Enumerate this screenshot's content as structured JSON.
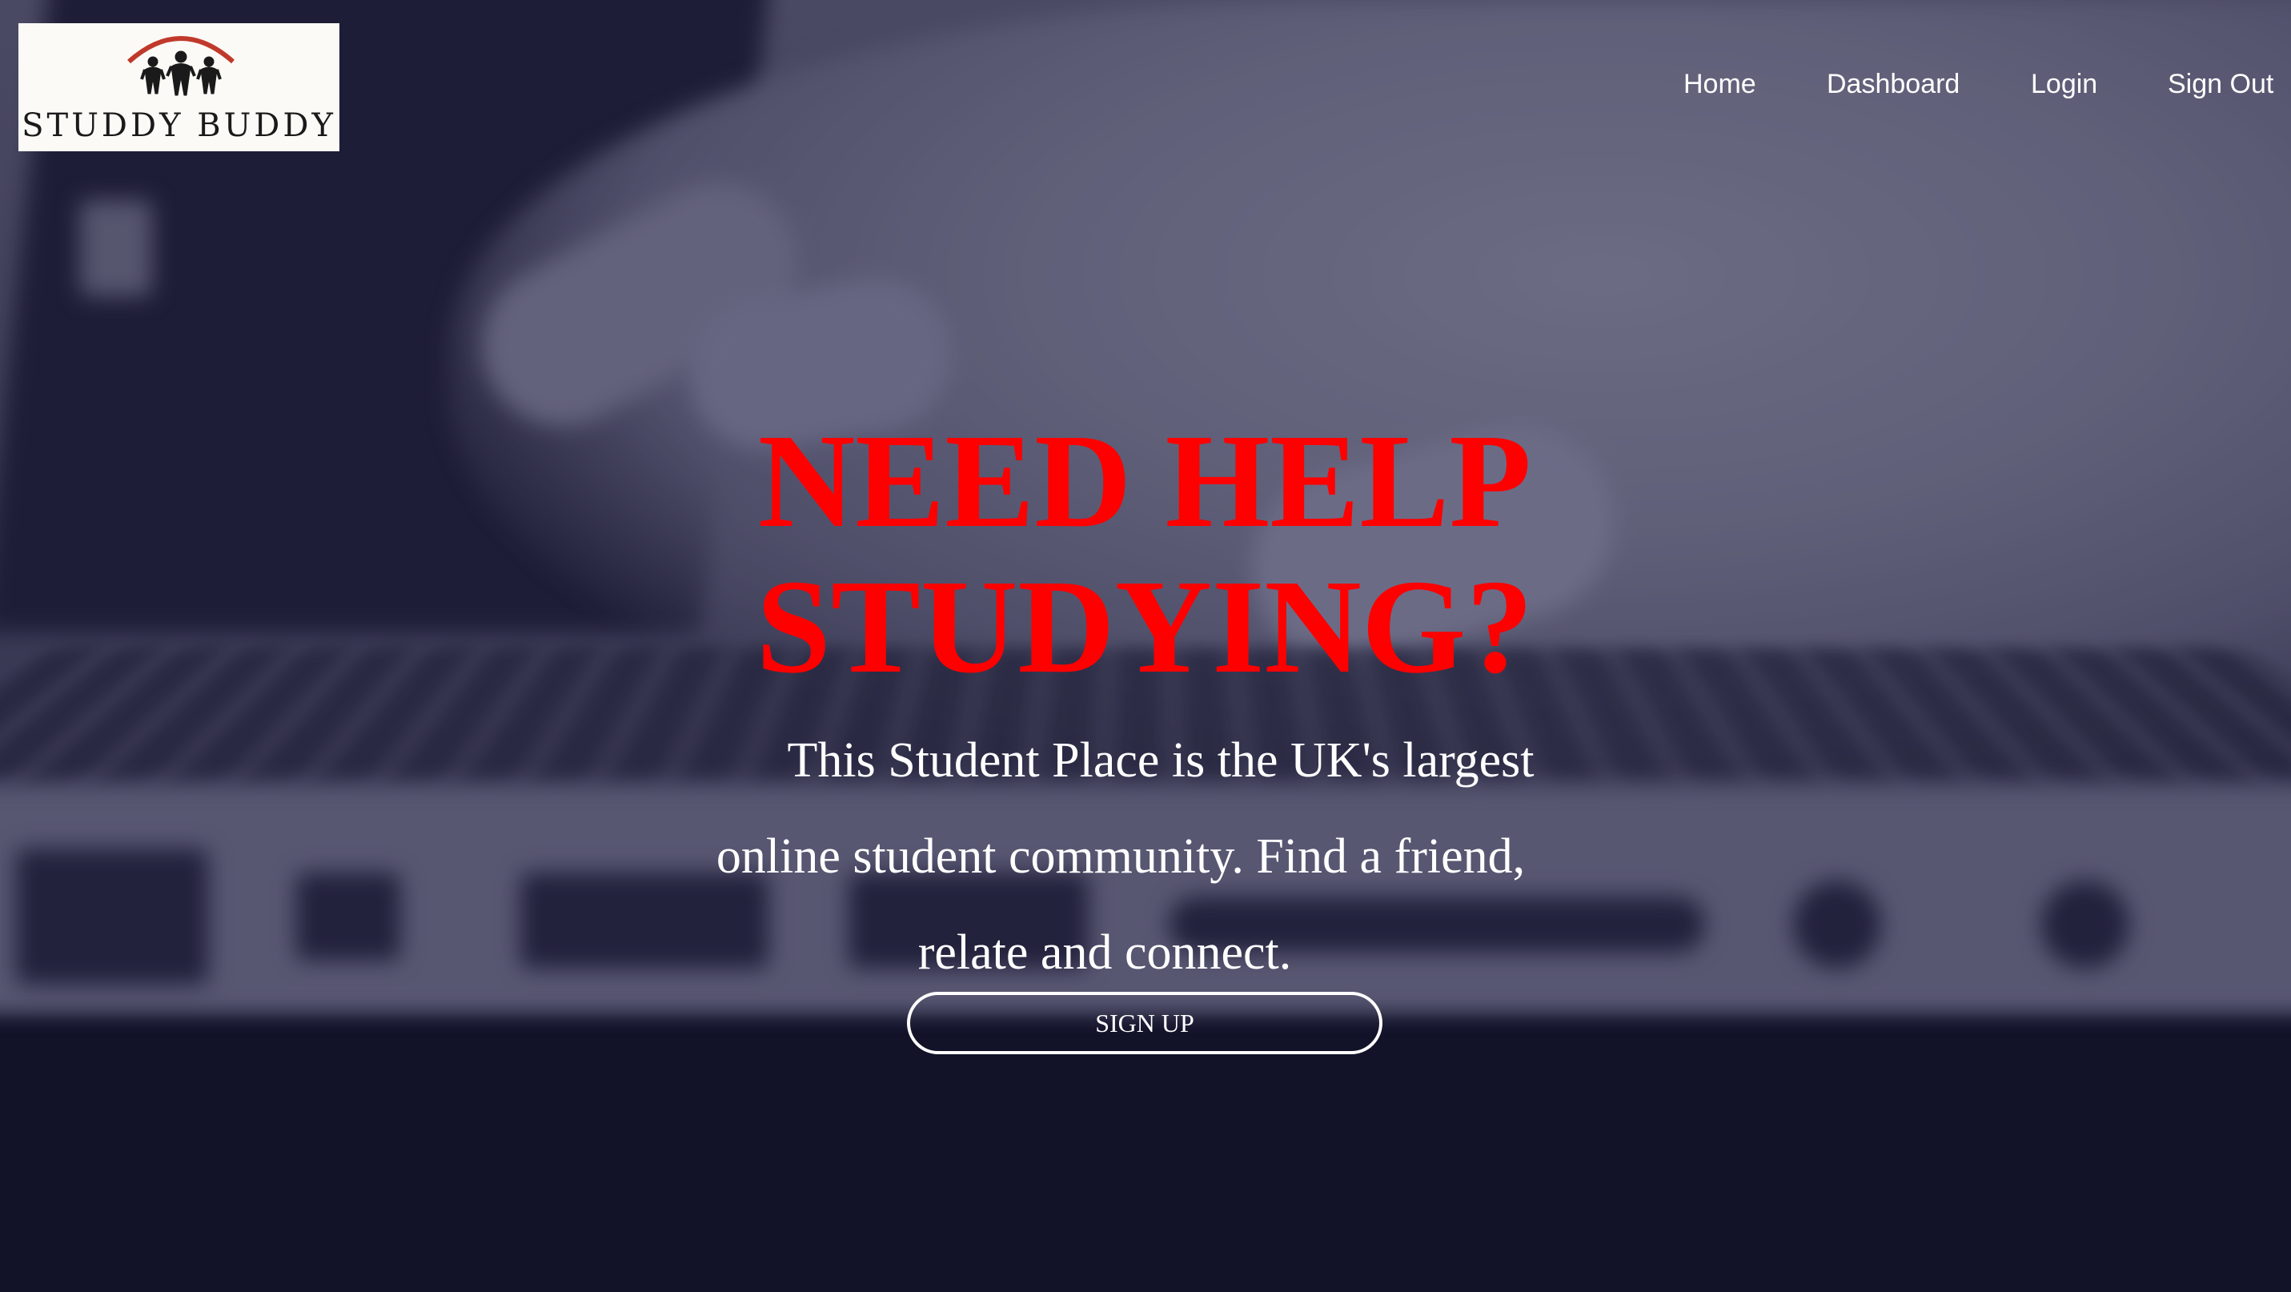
{
  "brand": {
    "name": "STUDDY BUDDY",
    "emblem_icon": "people-group-icon",
    "arc_color": "#c0392b"
  },
  "nav": {
    "items": [
      {
        "label": "Home"
      },
      {
        "label": "Dashboard"
      },
      {
        "label": "Login"
      },
      {
        "label": "Sign Out"
      }
    ]
  },
  "hero": {
    "title_line1": "NEED HELP",
    "title_line2": "STUDYING?",
    "tagline_line1": "This Student Place is the UK's largest",
    "tagline_line2": "online student community. Find a friend,",
    "tagline_line3": "relate and connect.",
    "cta_label": "SIGN UP",
    "title_color": "#ff0000"
  }
}
